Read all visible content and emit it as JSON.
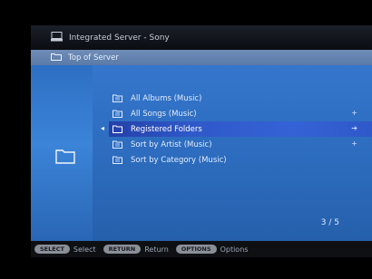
{
  "header": {
    "title": "Integrated Server - Sony",
    "icon": "server-icon"
  },
  "location": {
    "label": "Top of Server",
    "icon": "folder-icon"
  },
  "list": {
    "items": [
      {
        "label": "All Albums (Music)",
        "icon": "playlist-folder-icon",
        "selected": false,
        "right_marker": false
      },
      {
        "label": "All Songs (Music)",
        "icon": "playlist-folder-icon",
        "selected": false,
        "right_marker": true
      },
      {
        "label": "Registered Folders",
        "icon": "folder-icon",
        "selected": true,
        "right_marker": true
      },
      {
        "label": "Sort by Artist (Music)",
        "icon": "playlist-folder-icon",
        "selected": false,
        "right_marker": true
      },
      {
        "label": "Sort by Category (Music)",
        "icon": "playlist-folder-icon",
        "selected": false,
        "right_marker": false
      }
    ]
  },
  "page_count": "3 / 5",
  "footer": {
    "hints": [
      {
        "key": "SELECT",
        "label": "Select"
      },
      {
        "key": "RETURN",
        "label": "Return"
      },
      {
        "key": "OPTIONS",
        "label": "Options"
      }
    ]
  },
  "colors": {
    "panel": "#3576cc",
    "selection": "#2f58c8",
    "location_bar": "#6f8db7"
  }
}
